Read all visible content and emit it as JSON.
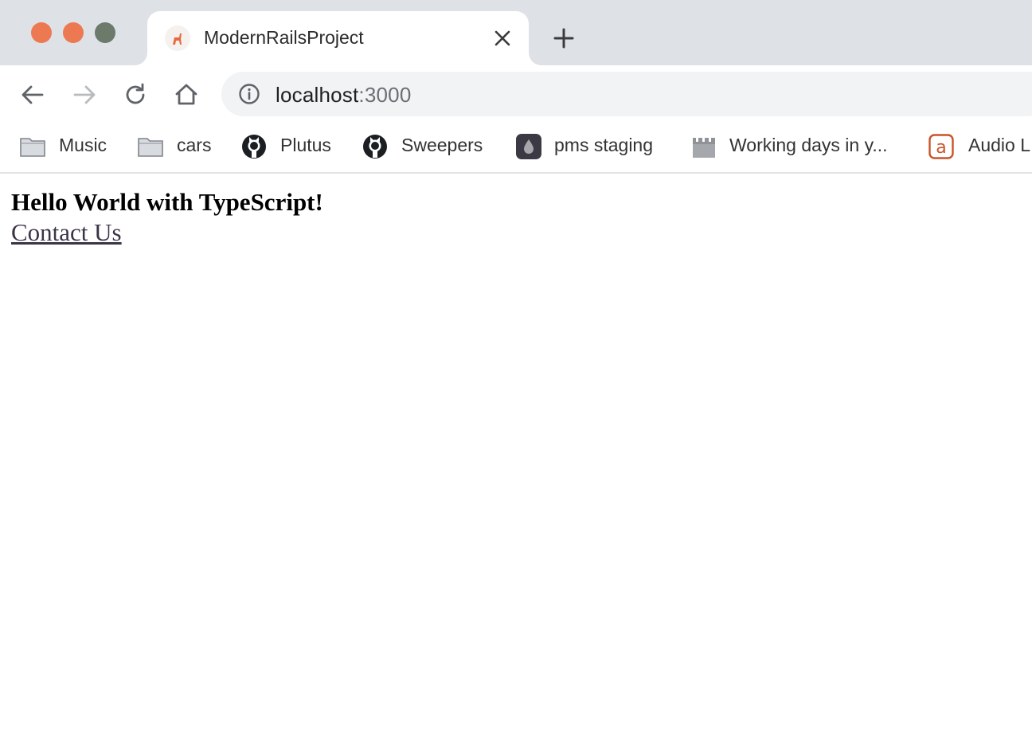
{
  "window": {
    "traffic_lights": {
      "close_color": "#ed7953",
      "minimize_color": "#ed7953",
      "maximize_color": "#6b7a6b"
    }
  },
  "tabs": [
    {
      "title": "ModernRailsProject",
      "favicon": "rails-icon",
      "active": true
    }
  ],
  "toolbar": {
    "back": "back-arrow-icon",
    "forward": "forward-arrow-icon",
    "reload": "reload-icon",
    "home": "home-icon"
  },
  "address_bar": {
    "host": "localhost",
    "port": ":3000",
    "security_icon": "info-icon"
  },
  "bookmarks": [
    {
      "label": "Music",
      "icon": "folder-icon"
    },
    {
      "label": "cars",
      "icon": "folder-icon"
    },
    {
      "label": "Plutus",
      "icon": "github-icon"
    },
    {
      "label": "Sweepers",
      "icon": "github-icon"
    },
    {
      "label": "pms staging",
      "icon": "drop-icon"
    },
    {
      "label": "Working days in y...",
      "icon": "calendar-icon"
    },
    {
      "label": "Audio L",
      "icon": "audio-a-icon"
    }
  ],
  "page": {
    "heading": "Hello World with TypeScript!",
    "link": "Contact Us"
  }
}
